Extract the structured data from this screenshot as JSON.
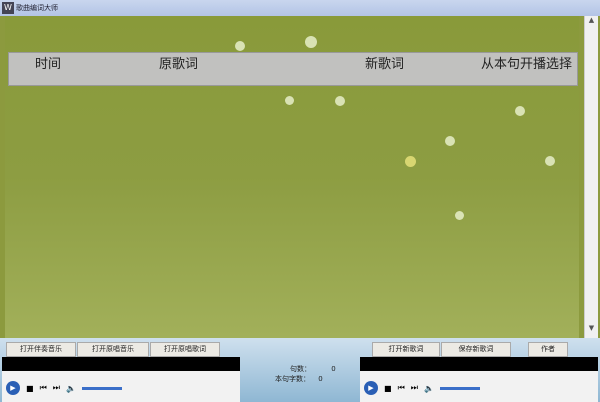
{
  "window": {
    "title": "歌曲编词大师"
  },
  "table": {
    "columns": [
      "时间",
      "原歌词",
      "新歌词",
      "从本句开播选择"
    ]
  },
  "buttons": {
    "open_accompaniment": "打开伴奏音乐",
    "open_original_music": "打开原唱音乐",
    "open_original_lyrics": "打开原唱歌词",
    "open_new_lyrics": "打开新歌词",
    "save_new_lyrics": "保存新歌词",
    "author": "作者"
  },
  "status": {
    "line_count_label": "句数：",
    "line_count": "0",
    "char_count_label": "本句字数：",
    "char_count": "0"
  }
}
